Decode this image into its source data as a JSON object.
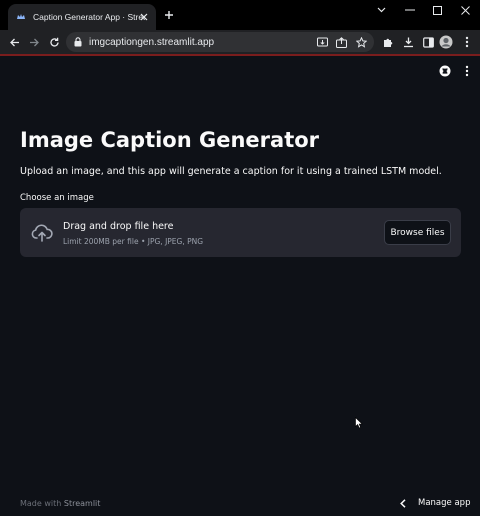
{
  "browser": {
    "tab_title": "Caption Generator App · Streamlit",
    "url": "imgcaptiongen.streamlit.app",
    "icons": {
      "favicon": "streamlit-crown-icon",
      "close": "close-icon",
      "new_tab": "plus-icon",
      "window": [
        "chevron-down-icon",
        "minimize-icon",
        "maximize-icon",
        "close-icon"
      ],
      "nav": [
        "back-arrow-icon",
        "forward-arrow-icon",
        "reload-icon"
      ],
      "omnibox": [
        "lock-icon",
        "install-app-icon",
        "share-icon",
        "bookmark-star-icon"
      ],
      "toolbar": [
        "extensions-puzzle-icon",
        "download-icon",
        "side-panel-icon",
        "profile-avatar-icon",
        "kebab-menu-icon"
      ]
    }
  },
  "app": {
    "title": "Image Caption Generator",
    "description": "Upload an image, and this app will generate a caption for it using a trained LSTM model.",
    "uploader": {
      "label": "Choose an image",
      "drag_text": "Drag and drop file here",
      "limit_text": "Limit 200MB per file • JPG, JPEG, PNG",
      "browse_label": "Browse files"
    },
    "footer": {
      "made_with_prefix": "Made with ",
      "made_with_brand": "Streamlit",
      "manage_label": "Manage app"
    }
  },
  "colors": {
    "background": "#0e1117",
    "surface": "#262730",
    "text": "#fafafa",
    "muted_text": "#9ba1ac",
    "browser_frame": "#202124",
    "accent_line": "#7a1d1d"
  }
}
